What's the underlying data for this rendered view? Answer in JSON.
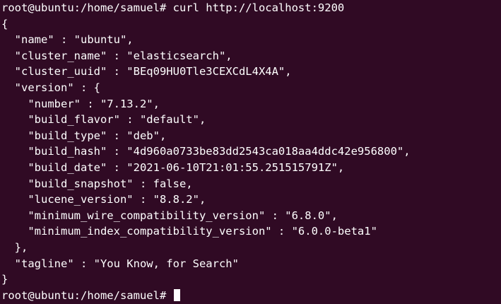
{
  "terminal": {
    "lines": [
      "root@ubuntu:/home/samuel# curl http://localhost:9200",
      "{",
      "  \"name\" : \"ubuntu\",",
      "  \"cluster_name\" : \"elasticsearch\",",
      "  \"cluster_uuid\" : \"BEq09HU0Tle3CEXCdL4X4A\",",
      "  \"version\" : {",
      "    \"number\" : \"7.13.2\",",
      "    \"build_flavor\" : \"default\",",
      "    \"build_type\" : \"deb\",",
      "    \"build_hash\" : \"4d960a0733be83dd2543ca018aa4ddc42e956800\",",
      "    \"build_date\" : \"2021-06-10T21:01:55.251515791Z\",",
      "    \"build_snapshot\" : false,",
      "    \"lucene_version\" : \"8.8.2\",",
      "    \"minimum_wire_compatibility_version\" : \"6.8.0\",",
      "    \"minimum_index_compatibility_version\" : \"6.0.0-beta1\"",
      "  },",
      "  \"tagline\" : \"You Know, for Search\"",
      "}"
    ],
    "prompt": "root@ubuntu:/home/samuel# "
  }
}
